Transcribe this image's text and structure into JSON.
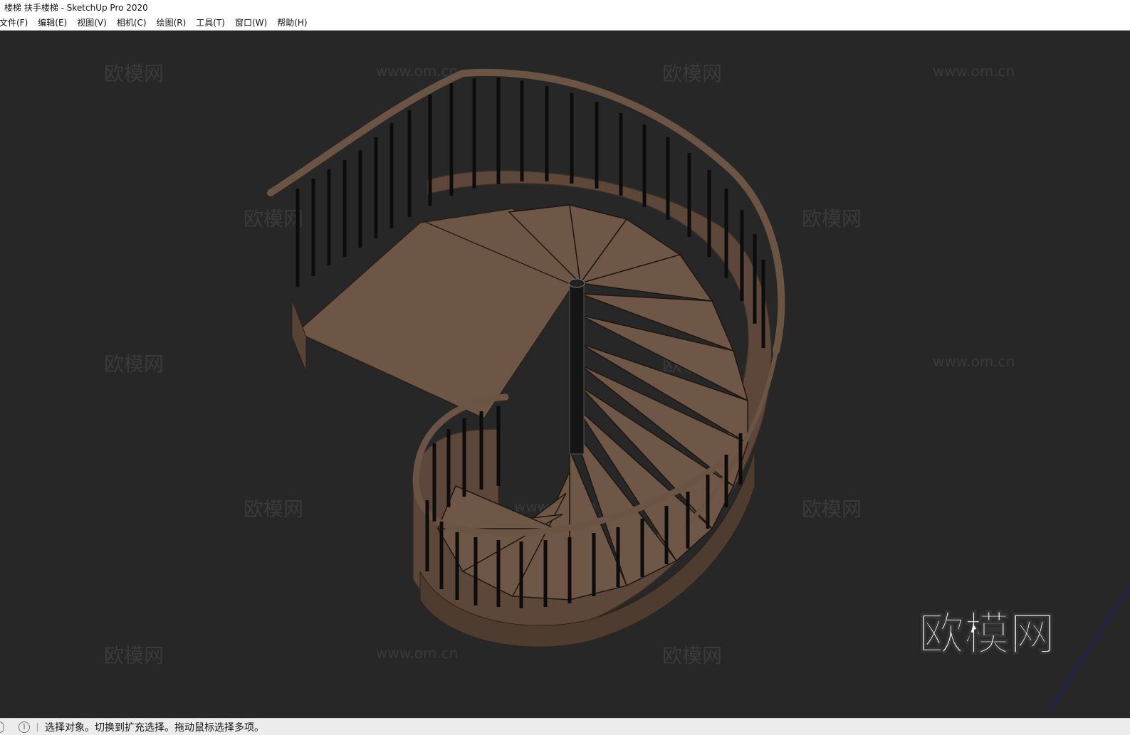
{
  "window": {
    "title": "楼梯 扶手楼梯 - SketchUp Pro 2020"
  },
  "menu": {
    "items": [
      "文件(F)",
      "编辑(E)",
      "视图(V)",
      "相机(C)",
      "绘图(R)",
      "工具(T)",
      "窗口(W)",
      "帮助(H)"
    ]
  },
  "viewport": {
    "watermark_text_a": "欧模网",
    "watermark_text_b": "www.om.cn",
    "logo_text": "欧模网",
    "colors": {
      "background": "#272727",
      "wood": "#6b5444",
      "wood_light": "#7a6050",
      "baluster": "#0c0c0c",
      "axis_blue": "#1a1a8a"
    }
  },
  "status": {
    "info_icon": "info-icon",
    "message": "选择对象。切换到扩充选择。拖动鼠标选择多项。"
  }
}
